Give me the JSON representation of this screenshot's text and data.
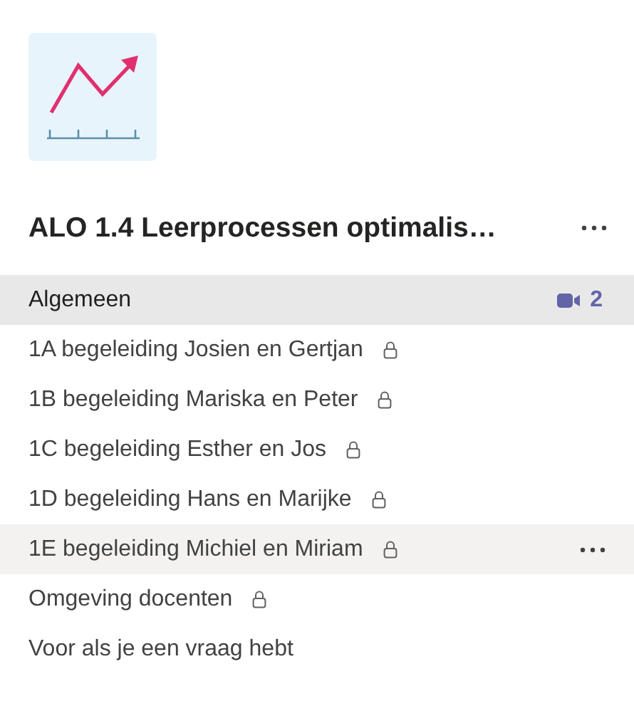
{
  "team": {
    "name": "ALO 1.4 Leerprocessen optimalis…"
  },
  "channels": [
    {
      "name": "Algemeen",
      "selected": true,
      "hovered": false,
      "private": false,
      "meeting": "2"
    },
    {
      "name": "1A begeleiding Josien en Gertjan",
      "selected": false,
      "hovered": false,
      "private": true
    },
    {
      "name": "1B begeleiding Mariska en Peter",
      "selected": false,
      "hovered": false,
      "private": true
    },
    {
      "name": "1C begeleiding Esther en Jos",
      "selected": false,
      "hovered": false,
      "private": true
    },
    {
      "name": "1D begeleiding Hans en Marijke",
      "selected": false,
      "hovered": false,
      "private": true
    },
    {
      "name": "1E begeleiding Michiel en Miriam",
      "selected": false,
      "hovered": true,
      "private": true
    },
    {
      "name": "Omgeving docenten",
      "selected": false,
      "hovered": false,
      "private": true
    },
    {
      "name": "Voor als je een vraag hebt",
      "selected": false,
      "hovered": false,
      "private": false
    }
  ]
}
